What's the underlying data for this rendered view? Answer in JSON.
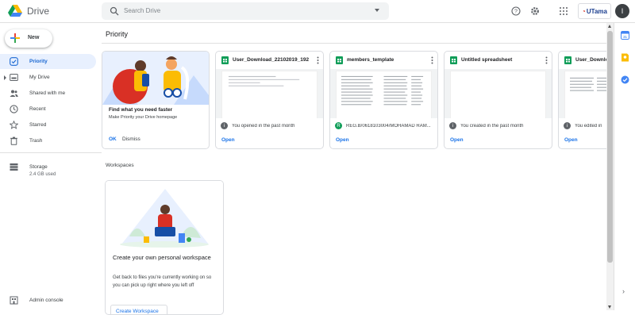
{
  "app": {
    "title": "Drive"
  },
  "search": {
    "placeholder": "Search Drive"
  },
  "header": {
    "brand_text": "UTama",
    "avatar_initial": "I"
  },
  "sidebar": {
    "new_label": "New",
    "items": [
      {
        "label": "Priority",
        "icon": "check-circle-icon"
      },
      {
        "label": "My Drive",
        "icon": "drive-folder-icon"
      },
      {
        "label": "Shared with me",
        "icon": "people-icon"
      },
      {
        "label": "Recent",
        "icon": "clock-icon"
      },
      {
        "label": "Starred",
        "icon": "star-icon"
      },
      {
        "label": "Trash",
        "icon": "trash-icon"
      }
    ],
    "storage_label": "Storage",
    "storage_used": "2.4 GB used",
    "admin_label": "Admin console"
  },
  "main": {
    "title": "Priority",
    "promo": {
      "title": "Find what you need faster",
      "subtitle": "Make Priority your Drive homepage",
      "ok_label": "OK",
      "dismiss_label": "Dismiss"
    },
    "files": [
      {
        "name": "User_Download_22102019_192...",
        "reason": "You opened in the past month",
        "reason_icon": "info-icon",
        "open_label": "Open"
      },
      {
        "name": "members_template",
        "reason": "REG.B/0618103004/MOHAMAD RAM...",
        "reason_icon": "user-avatar-icon",
        "reason_initial": "R",
        "open_label": "Open"
      },
      {
        "name": "Untitled spreadsheet",
        "reason": "You created in the past month",
        "reason_icon": "info-icon",
        "open_label": "Open"
      },
      {
        "name": "User_Downloa",
        "reason": "You edited in",
        "reason_icon": "info-icon",
        "open_label": "Open"
      }
    ],
    "workspaces_label": "Workspaces",
    "workspace_card": {
      "title": "Create your own personal workspace",
      "description": "Get back to files you're currently working on so you can pick up right where you left off",
      "button_label": "Create Workspace"
    }
  },
  "colors": {
    "accent": "#1a73e8",
    "sheets_green": "#0f9d58",
    "active_bg": "#e8f0fe"
  }
}
